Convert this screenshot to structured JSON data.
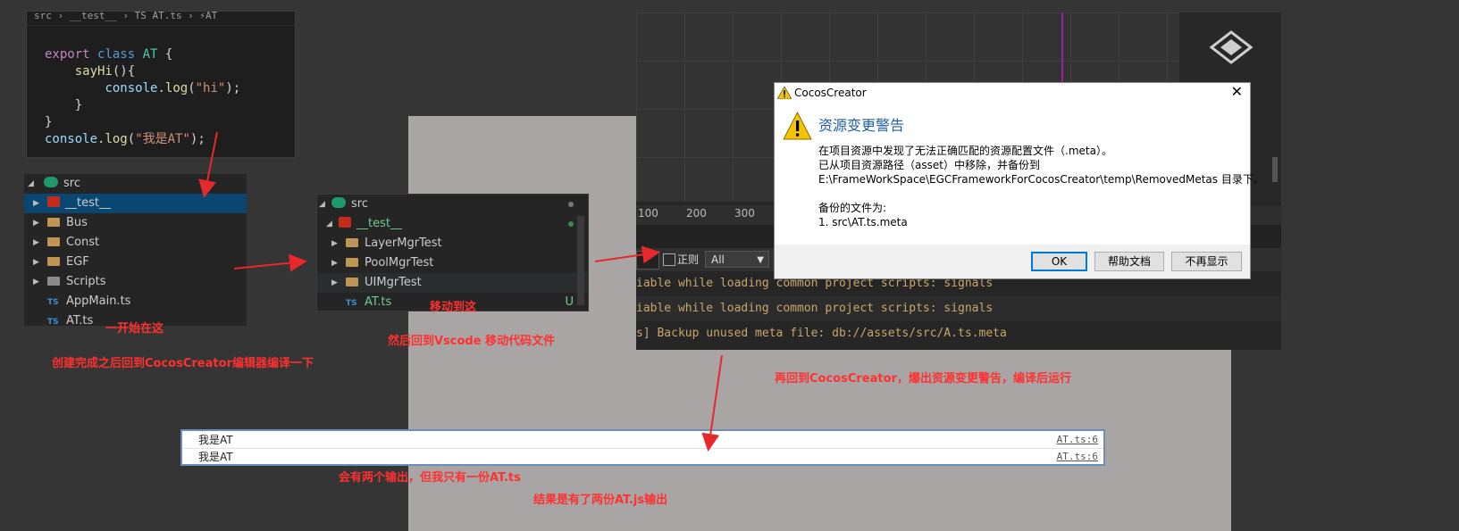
{
  "code_panel": {
    "breadcrumb": "src › __test__ › TS AT.ts › ⚡AT",
    "lines": [
      "export class AT {",
      "sayHi(){",
      "console.log(\"hi\");",
      "}",
      "}",
      "console.log(\"我是AT\");"
    ]
  },
  "tree_left": {
    "root": "src",
    "items": [
      "__test__",
      "Bus",
      "Const",
      "EGF",
      "Scripts",
      "AppMain.ts",
      "AT.ts"
    ],
    "ts_badge": "TS"
  },
  "tree_mid": {
    "root": "src",
    "test_folder": "__test__",
    "items": [
      "LayerMgrTest",
      "PoolMgrTest",
      "UIMgrTest",
      "AT.ts"
    ],
    "git_status": "U"
  },
  "scene": {
    "ruler_ticks": [
      "100",
      "200",
      "300"
    ]
  },
  "console_toolbar": {
    "regex_label": "正则",
    "filter_value": "All"
  },
  "console_lines": [
    "iable while loading common project scripts: signals",
    "iable while loading common project scripts: signals",
    "s] Backup unused meta file: db://assets/src/A.ts.meta"
  ],
  "dialog": {
    "window_title": "CocosCreator",
    "heading": "资源变更警告",
    "line1": "在项目资源中发现了无法正确匹配的资源配置文件（.meta）。",
    "line2": "已从项目资源路径（asset）中移除，并备份到",
    "line3": "E:\\FrameWorkSpace\\EGCFrameworkForCocosCreator\\temp\\RemovedMetas 目录下。",
    "line4": "备份的文件为:",
    "line5": "1. src\\AT.ts.meta",
    "ok": "OK",
    "help": "帮助文档",
    "dont_show": "不再显示"
  },
  "log_panel": {
    "rows": [
      {
        "text": "我是AT",
        "source": "AT.ts:6"
      },
      {
        "text": "我是AT",
        "source": "AT.ts:6"
      }
    ]
  },
  "annotations": {
    "start_here": "一开始在这",
    "compile_note": "创建完成之后回到CocosCreator编辑器编译一下",
    "move_here": "移动到这",
    "back_vscode": "然后回到Vscode 移动代码文件",
    "back_cocos": "再回到CocosCreator，爆出资源变更警告，编译后运行",
    "two_outputs": "会有两个输出，但我只有一份AT.ts",
    "result": "结果是有了两份AT.js输出"
  },
  "colors": {
    "annotation": "#ff3030",
    "selection": "#094771",
    "guide_line": "#9b1fa0"
  }
}
